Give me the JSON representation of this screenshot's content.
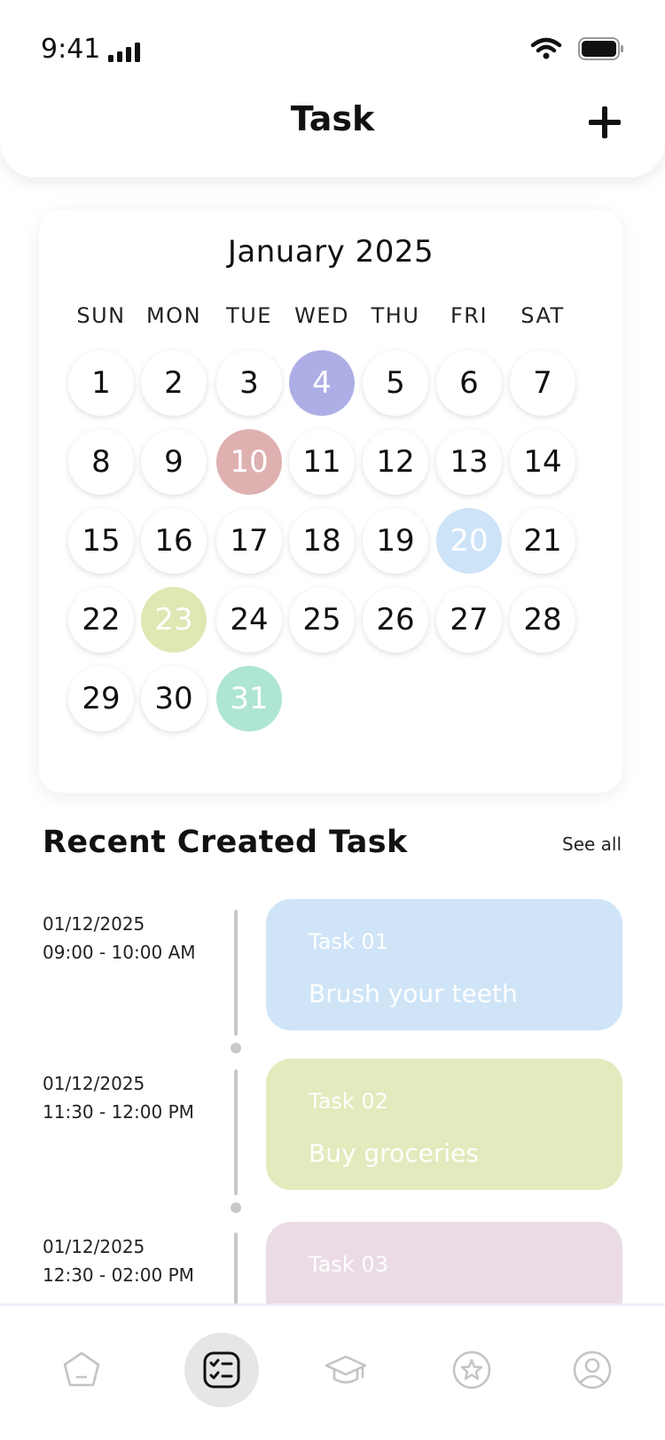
{
  "status_bar": {
    "time": "9:41"
  },
  "header": {
    "title": "Task"
  },
  "calendar": {
    "month": "January 2025",
    "weekdays": [
      "SUN",
      "MON",
      "TUE",
      "WED",
      "THU",
      "FRI",
      "SAT"
    ],
    "days": [
      "1",
      "2",
      "3",
      "4",
      "5",
      "6",
      "7",
      "8",
      "9",
      "10",
      "11",
      "12",
      "13",
      "14",
      "15",
      "16",
      "17",
      "18",
      "19",
      "20",
      "21",
      "22",
      "23",
      "24",
      "25",
      "26",
      "27",
      "28",
      "29",
      "30",
      "31"
    ],
    "highlighted": [
      {
        "day": "4",
        "color": "#aeaee6"
      },
      {
        "day": "10",
        "color": "#dfb0b0"
      },
      {
        "day": "20",
        "color": "#cde3f7"
      },
      {
        "day": "23",
        "color": "#dfe7b2"
      },
      {
        "day": "31",
        "color": "#aee5d3"
      }
    ]
  },
  "recent": {
    "title": "Recent Created Task",
    "see_all": "See all",
    "tasks": [
      {
        "date": "01/12/2025",
        "time": "09:00 - 10:00 AM",
        "title": "Task 01",
        "desc": "Brush your teeth",
        "color": "#cfe4f7"
      },
      {
        "date": "01/12/2025",
        "time": "11:30 - 12:00 PM",
        "title": "Task 02",
        "desc": "Buy groceries",
        "color": "#e3eabd"
      },
      {
        "date": "01/12/2025",
        "time": "12:30 - 02:00 PM",
        "title": "Task 03",
        "desc": "",
        "color": "#eadbe5"
      }
    ]
  },
  "bottom_nav": {
    "items": [
      {
        "icon": "home-icon",
        "active": false
      },
      {
        "icon": "task-list-icon",
        "active": true
      },
      {
        "icon": "graduation-cap-icon",
        "active": false
      },
      {
        "icon": "star-icon",
        "active": false
      },
      {
        "icon": "profile-icon",
        "active": false
      }
    ]
  }
}
